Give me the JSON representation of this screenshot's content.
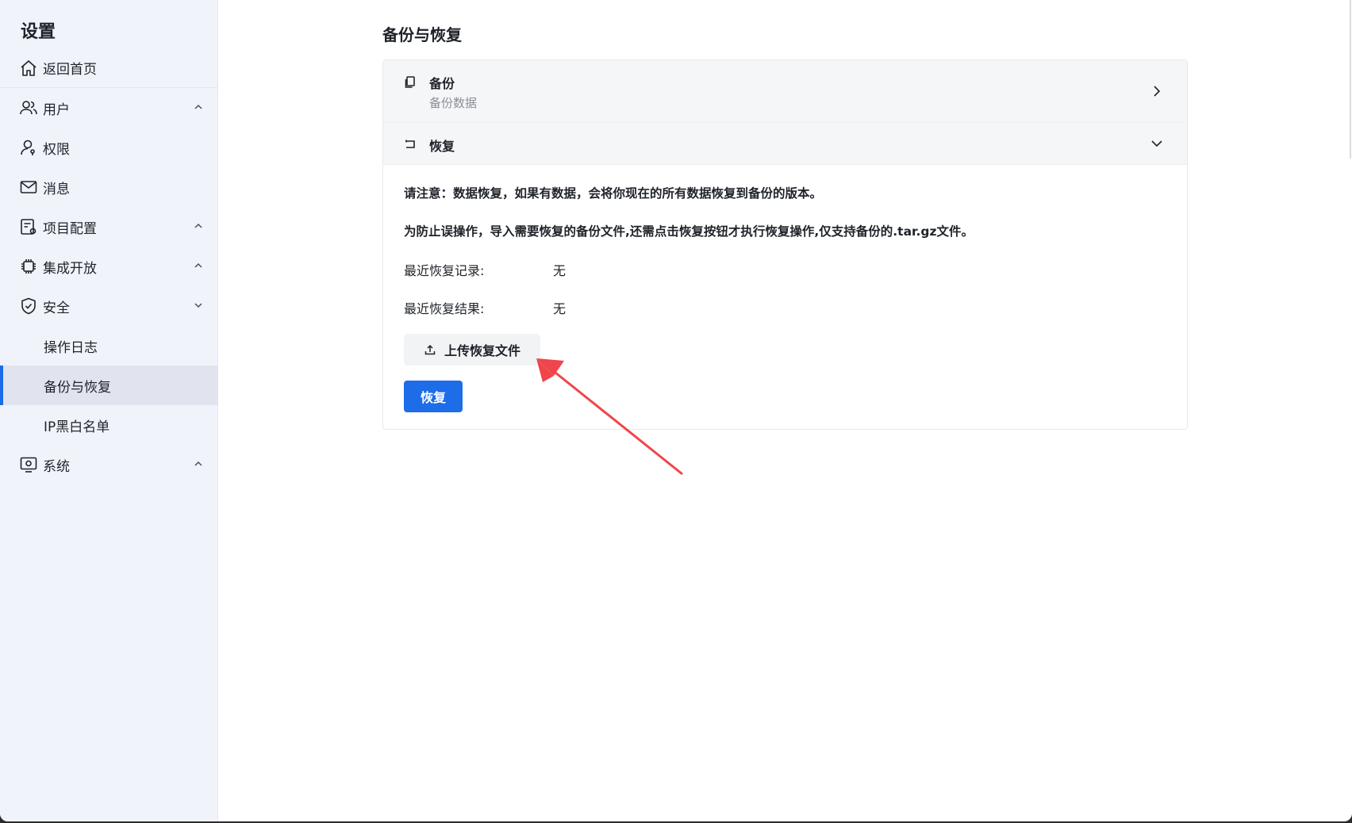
{
  "sidebar": {
    "title": "设置",
    "items": [
      {
        "label": "返回首页",
        "icon": "home-icon"
      },
      {
        "label": "用户",
        "icon": "users-icon",
        "chevron": "up"
      },
      {
        "label": "权限",
        "icon": "user-key-icon"
      },
      {
        "label": "消息",
        "icon": "mail-icon"
      },
      {
        "label": "项目配置",
        "icon": "project-config-icon",
        "chevron": "up"
      },
      {
        "label": "集成开放",
        "icon": "chip-icon",
        "chevron": "up"
      },
      {
        "label": "安全",
        "icon": "shield-icon",
        "chevron": "down"
      },
      {
        "label": "操作日志"
      },
      {
        "label": "备份与恢复",
        "active": true
      },
      {
        "label": "IP黑白名单"
      },
      {
        "label": "系统",
        "icon": "monitor-icon",
        "chevron": "up"
      }
    ]
  },
  "main": {
    "title": "备份与恢复",
    "backup": {
      "title": "备份",
      "subtitle": "备份数据",
      "icon": "copy-icon",
      "arrow": "chevron-right-icon"
    },
    "restore": {
      "title": "恢复",
      "icon": "return-icon",
      "arrow": "chevron-down-icon",
      "notice1": "请注意：数据恢复，如果有数据，会将你现在的所有数据恢复到备份的版本。",
      "notice2": "为防止误操作，导入需要恢复的备份文件,还需点击恢复按钮才执行恢复操作,仅支持备份的.tar.gz文件。",
      "last_record_label": "最近恢复记录:",
      "last_record_value": "无",
      "last_result_label": "最近恢复结果:",
      "last_result_value": "无",
      "upload_label": "上传恢复文件",
      "restore_button": "恢复"
    }
  },
  "colors": {
    "accent": "#1d6ce8",
    "sidebar_bg": "#f1f3fb",
    "annotation_arrow": "#f0454a"
  }
}
